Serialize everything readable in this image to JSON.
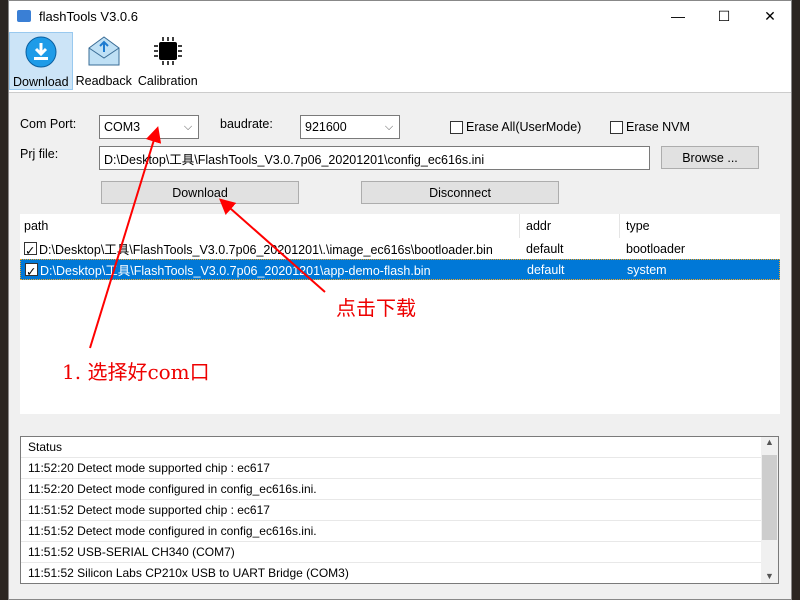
{
  "window": {
    "title": "flashTools V3.0.6",
    "minimize": "—",
    "maximize": "☐",
    "close": "✕"
  },
  "toolbar": {
    "items": [
      {
        "label": "Download",
        "icon": "download-icon",
        "selected": true
      },
      {
        "label": "Readback",
        "icon": "envelope-upload-icon"
      },
      {
        "label": "Calibration",
        "icon": "chip-icon"
      }
    ]
  },
  "form": {
    "com_port_label": "Com Port:",
    "com_port_value": "COM3",
    "baudrate_label": "baudrate:",
    "baudrate_value": "921600",
    "erase_all_label": "Erase All(UserMode)",
    "erase_all_checked": false,
    "erase_nvm_label": "Erase NVM",
    "erase_nvm_checked": false,
    "prj_file_label": "Prj file:",
    "prj_file_value": "D:\\Desktop\\工具\\FlashTools_V3.0.7p06_20201201\\config_ec616s.ini",
    "browse_label": "Browse ...",
    "download_label": "Download",
    "disconnect_label": "Disconnect"
  },
  "files": {
    "columns": [
      "path",
      "addr",
      "type"
    ],
    "rows": [
      {
        "checked": true,
        "path": "D:\\Desktop\\工具\\FlashTools_V3.0.7p06_20201201\\.\\image_ec616s\\bootloader.bin",
        "addr": "default",
        "type": "bootloader",
        "selected": false
      },
      {
        "checked": true,
        "path": "D:\\Desktop\\工具\\FlashTools_V3.0.7p06_20201201\\app-demo-flash.bin",
        "addr": "default",
        "type": "system",
        "selected": true
      }
    ]
  },
  "status": {
    "header": "Status",
    "lines": [
      "11:52:20 Detect mode supported chip : ec617",
      "11:52:20 Detect mode configured in  config_ec616s.ini.",
      "11:51:52 Detect mode supported chip : ec617",
      "11:51:52 Detect mode configured in  config_ec616s.ini.",
      "11:51:52 USB-SERIAL CH340 (COM7)",
      "11:51:52 Silicon Labs CP210x USB to UART Bridge (COM3)"
    ]
  },
  "annotations": {
    "click_download": "点击下载",
    "select_com": "1. 选择好com口",
    "color": "#e00000"
  }
}
